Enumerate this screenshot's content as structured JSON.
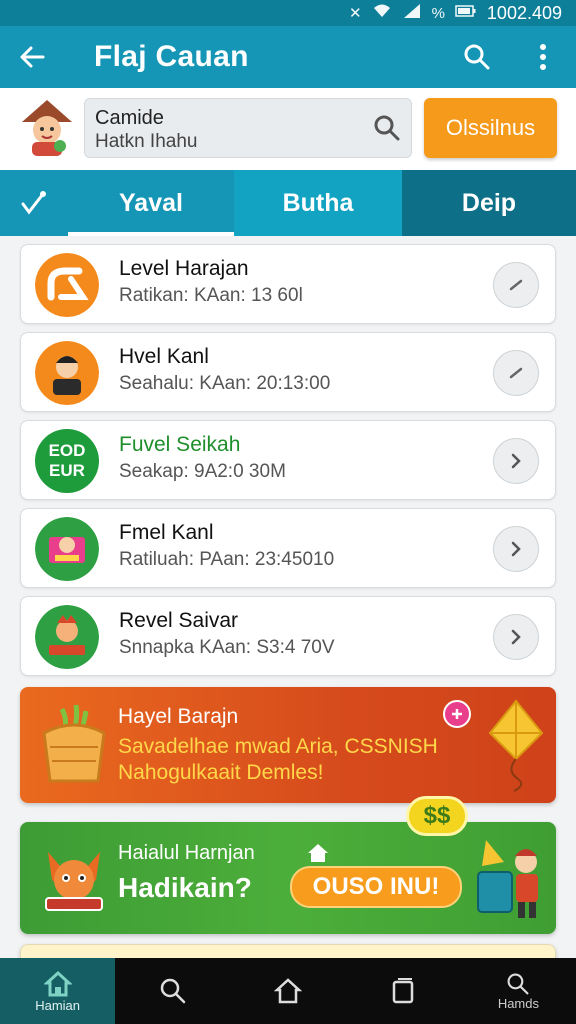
{
  "status_bar": {
    "time": "1002.409",
    "battery_text": "%"
  },
  "app_bar": {
    "title": "Flaj Cauan"
  },
  "search": {
    "line1": "Camide",
    "line2": "Hatkn Ihahu",
    "button_label": "Olssilnus"
  },
  "tabs": [
    {
      "label": "Yaval"
    },
    {
      "label": "Butha"
    },
    {
      "label": "Deip"
    }
  ],
  "list": [
    {
      "title": "Level Harajan",
      "subtitle": "Ratikan: KAan: 13 60l"
    },
    {
      "title": "Hvel Kanl",
      "subtitle": "Seahalu: KAan: 20:13:00"
    },
    {
      "title": "Fuvel Seikah",
      "subtitle": "Seakap: 9A2:0 30M",
      "title_color": "#1e8f2a",
      "icon_text": "EOD EUR"
    },
    {
      "title": "Fmel Kanl",
      "subtitle": "Ratiluah: PAan: 23:45010"
    },
    {
      "title": "Revel Saivar",
      "subtitle": "Snnapka KAan: S3:4 70V"
    }
  ],
  "banner1": {
    "title": "Hayel Barajn",
    "line2": "Savadelhae mwad Aria, CSSNISH",
    "line3": "Nahogulkaait Demles!"
  },
  "banner2": {
    "subtitle": "Haialul Harnjan",
    "headline": "Hadikain?",
    "cta": "OUSO INU!",
    "badge": "$$"
  },
  "bottom_nav": [
    {
      "label": "Hamian",
      "icon": "home-icon"
    },
    {
      "label": "",
      "icon": "search-icon"
    },
    {
      "label": "",
      "icon": "home-outline-icon"
    },
    {
      "label": "",
      "icon": "recent-apps-icon"
    },
    {
      "label": "Hamds",
      "icon": "search-icon"
    }
  ],
  "colors": {
    "primary": "#1596b6",
    "accent": "#f59a1b",
    "green": "#4cae3a",
    "orange": "#e0561c"
  }
}
